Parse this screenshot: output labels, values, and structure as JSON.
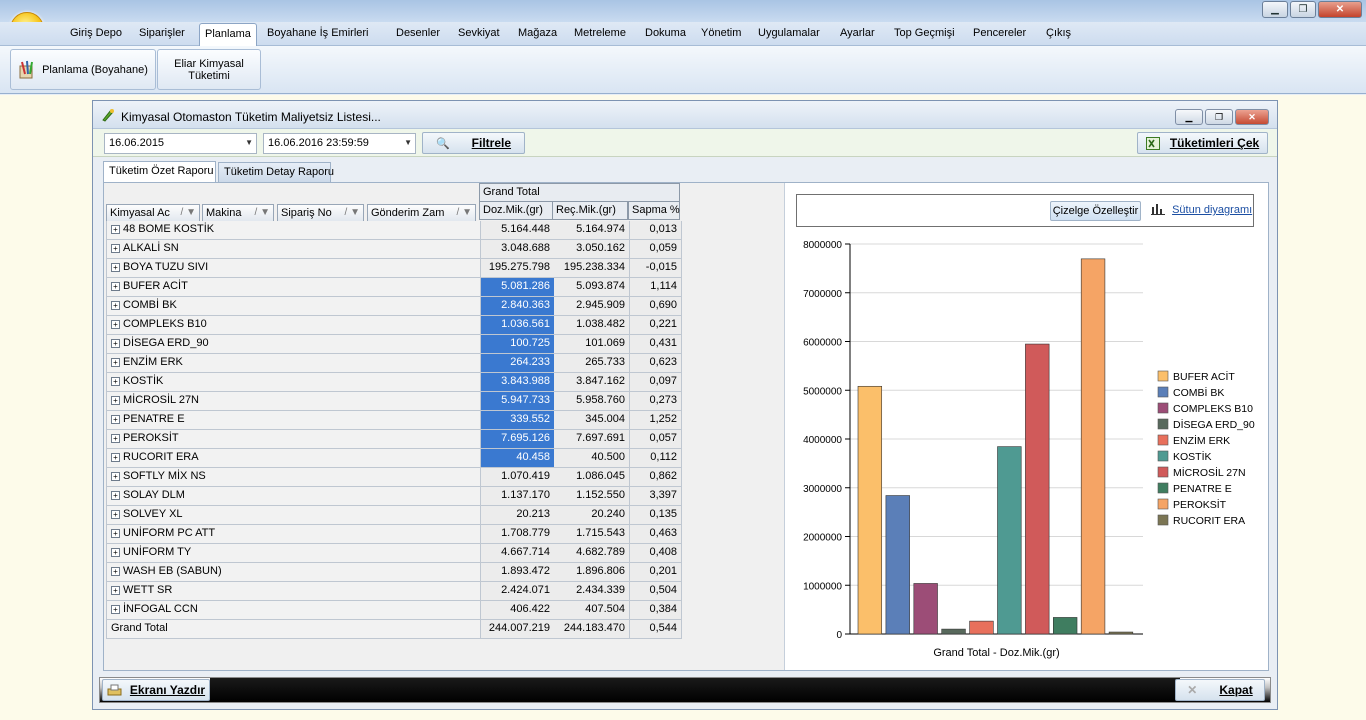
{
  "menu": {
    "items": [
      "Giriş Depo",
      "Siparişler",
      "Planlama",
      "Boyahane İş Emirleri",
      "Desenler",
      "Sevkiyat",
      "Mağaza",
      "Metreleme",
      "Dokuma",
      "Yönetim",
      "Uygulamalar",
      "Ayarlar",
      "Top Geçmişi",
      "Pencereler",
      "Çıkış"
    ],
    "active": "Planlama"
  },
  "ribbon": {
    "btn1": "Planlama (Boyahane)",
    "btn2_line1": "Eliar Kimyasal",
    "btn2_line2": "Tüketimi"
  },
  "window": {
    "title": "Kimyasal Otomaston Tüketim Maliyetsiz Listesi...",
    "date_from": "16.06.2015",
    "date_to": "16.06.2016 23:59:59",
    "filter_label": "Filtrele",
    "fetch_label": "Tüketimleri Çek",
    "print_label": "Ekranı Yazdır",
    "close_label": "Kapat"
  },
  "tabs": [
    "Tüketim Özet Raporu",
    "Tüketim Detay Raporu"
  ],
  "pivot": {
    "fields": [
      "Kimyasal Ac",
      "Makina",
      "Sipariş No",
      "Gönderim Zam"
    ],
    "grand_header": "Grand Total",
    "columns": [
      "Doz.Mik.(gr)",
      "Reç.Mik.(gr)",
      "Sapma %"
    ],
    "rows": [
      {
        "name": "48 BOME KOSTİK",
        "doz": "5.164.448",
        "rec": "5.164.974",
        "sap": "0,013",
        "sel": false
      },
      {
        "name": "ALKALİ SN",
        "doz": "3.048.688",
        "rec": "3.050.162",
        "sap": "0,059",
        "sel": false
      },
      {
        "name": "BOYA TUZU SIVI",
        "doz": "195.275.798",
        "rec": "195.238.334",
        "sap": "-0,015",
        "sel": false
      },
      {
        "name": "BUFER ACİT",
        "doz": "5.081.286",
        "rec": "5.093.874",
        "sap": "1,114",
        "sel": true
      },
      {
        "name": "COMBİ BK",
        "doz": "2.840.363",
        "rec": "2.945.909",
        "sap": "0,690",
        "sel": true
      },
      {
        "name": "COMPLEKS B10",
        "doz": "1.036.561",
        "rec": "1.038.482",
        "sap": "0,221",
        "sel": true
      },
      {
        "name": "DİSEGA ERD_90",
        "doz": "100.725",
        "rec": "101.069",
        "sap": "0,431",
        "sel": true
      },
      {
        "name": "ENZİM ERK",
        "doz": "264.233",
        "rec": "265.733",
        "sap": "0,623",
        "sel": true
      },
      {
        "name": "KOSTİK",
        "doz": "3.843.988",
        "rec": "3.847.162",
        "sap": "0,097",
        "sel": true
      },
      {
        "name": "MİCROSİL 27N",
        "doz": "5.947.733",
        "rec": "5.958.760",
        "sap": "0,273",
        "sel": true
      },
      {
        "name": "PENATRE E",
        "doz": "339.552",
        "rec": "345.004",
        "sap": "1,252",
        "sel": true
      },
      {
        "name": "PEROKSİT",
        "doz": "7.695.126",
        "rec": "7.697.691",
        "sap": "0,057",
        "sel": true
      },
      {
        "name": "RUCORIT ERA",
        "doz": "40.458",
        "rec": "40.500",
        "sap": "0,112",
        "sel": true
      },
      {
        "name": "SOFTLY MİX NS",
        "doz": "1.070.419",
        "rec": "1.086.045",
        "sap": "0,862",
        "sel": false
      },
      {
        "name": "SOLAY DLM",
        "doz": "1.137.170",
        "rec": "1.152.550",
        "sap": "3,397",
        "sel": false
      },
      {
        "name": "SOLVEY XL",
        "doz": "20.213",
        "rec": "20.240",
        "sap": "0,135",
        "sel": false
      },
      {
        "name": "UNİFORM PC ATT",
        "doz": "1.708.779",
        "rec": "1.715.543",
        "sap": "0,463",
        "sel": false
      },
      {
        "name": "UNİFORM TY",
        "doz": "4.667.714",
        "rec": "4.682.789",
        "sap": "0,408",
        "sel": false
      },
      {
        "name": "WASH EB (SABUN)",
        "doz": "1.893.472",
        "rec": "1.896.806",
        "sap": "0,201",
        "sel": false
      },
      {
        "name": "WETT SR",
        "doz": "2.424.071",
        "rec": "2.434.339",
        "sap": "0,504",
        "sel": false
      },
      {
        "name": "İNFOGAL CCN",
        "doz": "406.422",
        "rec": "407.504",
        "sap": "0,384",
        "sel": false
      }
    ],
    "total": {
      "name": "Grand Total",
      "doz": "244.007.219",
      "rec": "244.183.470",
      "sap": "0,544"
    }
  },
  "chart_toolbar": {
    "customize": "Çizelge Özelleştir",
    "column_chart": "Sütun diyagramı"
  },
  "chart_data": {
    "type": "bar",
    "xlabel": "Grand Total - Doz.Mik.(gr)",
    "ylim": [
      0,
      8000000
    ],
    "yticks": [
      0,
      1000000,
      2000000,
      3000000,
      4000000,
      5000000,
      6000000,
      7000000,
      8000000
    ],
    "grid": true,
    "legend_position": "right",
    "series": [
      {
        "name": "BUFER ACİT",
        "value": 5081286,
        "color": "#fbbf6a"
      },
      {
        "name": "COMBİ BK",
        "value": 2840363,
        "color": "#5b7fb8"
      },
      {
        "name": "COMPLEKS B10",
        "value": 1036561,
        "color": "#9c4d77"
      },
      {
        "name": "DİSEGA ERD_90",
        "value": 100725,
        "color": "#58695c"
      },
      {
        "name": "ENZİM ERK",
        "value": 264233,
        "color": "#e8705c"
      },
      {
        "name": "KOSTİK",
        "value": 3843988,
        "color": "#4f9a92"
      },
      {
        "name": "MİCROSİL 27N",
        "value": 5947733,
        "color": "#d05a5a"
      },
      {
        "name": "PENATRE E",
        "value": 339552,
        "color": "#3f7d60"
      },
      {
        "name": "PEROKSİT",
        "value": 7695126,
        "color": "#f5a465"
      },
      {
        "name": "RUCORIT ERA",
        "value": 40458,
        "color": "#7c7654"
      }
    ]
  }
}
